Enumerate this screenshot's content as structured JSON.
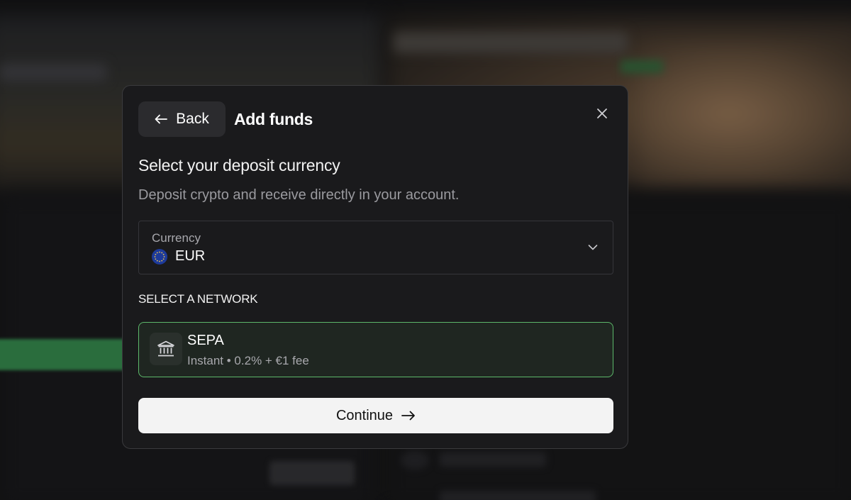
{
  "modal": {
    "back_label": "Back",
    "title": "Add funds",
    "heading": "Select your deposit currency",
    "subheading": "Deposit crypto and receive directly in your account.",
    "currency": {
      "label": "Currency",
      "value": "EUR",
      "icon": "eu-flag-icon"
    },
    "network_heading": "SELECT A NETWORK",
    "networks": [
      {
        "name": "SEPA",
        "details": "Instant • 0.2% + €1 fee",
        "icon": "bank-icon",
        "selected": true
      }
    ],
    "continue_label": "Continue"
  },
  "colors": {
    "modal_bg": "#1a1a1c",
    "selected_border": "#5cb86a",
    "selected_bg": "#1f2621",
    "primary_button_bg": "#f3f3f3",
    "eu_blue": "#1d3a9a",
    "eu_star": "#f2c94c"
  }
}
